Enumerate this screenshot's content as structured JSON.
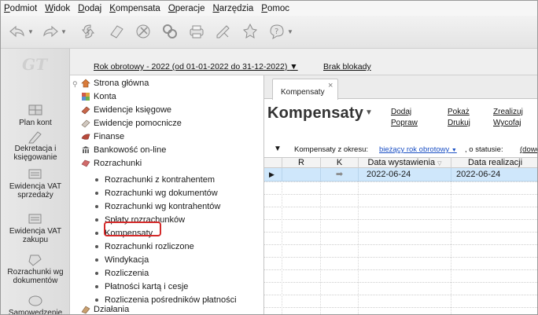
{
  "menu": [
    "Podmiot",
    "Widok",
    "Dodaj",
    "Kompensata",
    "Operacje",
    "Narzędzia",
    "Pomoc"
  ],
  "toolbar": {
    "icons": [
      "navigate-back-icon",
      "navigate-forward-icon",
      "refresh-icon",
      "eraser-icon",
      "tools-icon",
      "link-icon",
      "printer-icon",
      "edit-icon",
      "pin-icon",
      "help-icon"
    ]
  },
  "leftbar": {
    "logo": "GT",
    "items": [
      {
        "label": "Plan kont",
        "icon": "ledger-icon"
      },
      {
        "label": "Dekretacja i\nksięgowanie",
        "icon": "pencil-icon"
      },
      {
        "label": "Ewidencja VAT\nsprzedaży",
        "icon": "register-icon"
      },
      {
        "label": "Ewidencja VAT\nzakupu",
        "icon": "register-icon"
      },
      {
        "label": "Rozrachunki wg\ndokumentów",
        "icon": "documents-icon"
      },
      {
        "label": "Samowedzenie",
        "icon": "folder-icon"
      }
    ]
  },
  "infobar": {
    "fiscal_year": "Rok obrotowy - 2022  (od 01-01-2022 do 31-12-2022)",
    "lock_status": "Brak blokady"
  },
  "tree": {
    "top_items": [
      {
        "label": "Strona główna",
        "icon": "home-icon"
      },
      {
        "label": "Konta",
        "icon": "accounts-icon"
      },
      {
        "label": "Ewidencje księgowe",
        "icon": "ledger-icon"
      },
      {
        "label": "Ewidencje pomocnicze",
        "icon": "ledger-icon"
      },
      {
        "label": "Finanse",
        "icon": "finance-icon"
      },
      {
        "label": "Bankowość on-line",
        "icon": "bank-icon"
      },
      {
        "label": "Rozrachunki",
        "icon": "settlements-icon"
      }
    ],
    "sub_items": [
      "Rozrachunki z kontrahentem",
      "Rozrachunki wg dokumentów",
      "Rozrachunki wg kontrahentów",
      "Spłaty rozrachunków",
      "Kompensaty",
      "Rozrachunki rozliczone",
      "Windykacja",
      "Rozliczenia",
      "Płatności kartą i cesje",
      "Rozliczenia pośredników płatności"
    ],
    "bottom_item": {
      "label": "Działania",
      "icon": "actions-icon"
    }
  },
  "tab": {
    "label": "Kompensaty"
  },
  "title": "Kompensaty",
  "actions": {
    "add": "Dodaj",
    "fix": "Popraw",
    "show": "Pokaż",
    "print": "Drukuj",
    "settle": "Zrealizuj",
    "withdraw": "Wycofaj"
  },
  "filter": {
    "period_label": "Kompensaty z okresu:",
    "period_value": "bieżący rok obrotowy",
    "status_label": ", o statusie:",
    "status_value": "(dowo"
  },
  "grid": {
    "columns": [
      "R",
      "K",
      "Data wystawienia",
      "Data realizacji"
    ],
    "rows": [
      {
        "r": "",
        "k": "➡",
        "issue_date": "2022-06-24",
        "realization_date": "2022-06-24"
      }
    ]
  },
  "colors": {
    "highlight": "#d42a2a",
    "selected_row": "#cfe7fb",
    "link": "#1a4fc4"
  }
}
